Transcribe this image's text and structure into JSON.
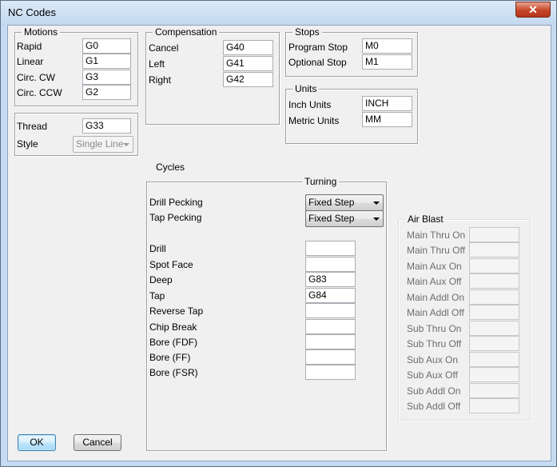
{
  "window": {
    "title": "NC Codes",
    "close_glyph": "✕"
  },
  "motions": {
    "legend": "Motions",
    "rows": [
      {
        "label": "Rapid",
        "value": "G0"
      },
      {
        "label": "Linear",
        "value": "G1"
      },
      {
        "label": "Circ. CW",
        "value": "G3"
      },
      {
        "label": "Circ. CCW",
        "value": "G2"
      }
    ]
  },
  "thread": {
    "label": "Thread",
    "value": "G33",
    "style_label": "Style",
    "style_value": "Single Line"
  },
  "compensation": {
    "legend": "Compensation",
    "rows": [
      {
        "label": "Cancel",
        "value": "G40"
      },
      {
        "label": "Left",
        "value": "G41"
      },
      {
        "label": "Right",
        "value": "G42"
      }
    ]
  },
  "stops": {
    "legend": "Stops",
    "rows": [
      {
        "label": "Program Stop",
        "value": "M0"
      },
      {
        "label": "Optional Stop",
        "value": "M1"
      }
    ]
  },
  "units": {
    "legend": "Units",
    "rows": [
      {
        "label": "Inch Units",
        "value": "INCH"
      },
      {
        "label": "Metric Units",
        "value": "MM"
      }
    ]
  },
  "cycles": {
    "label": "Cycles",
    "legend": "Turning",
    "drill_pecking": {
      "label": "Drill Pecking",
      "value": "Fixed Step"
    },
    "tap_pecking": {
      "label": "Tap Pecking",
      "value": "Fixed Step"
    },
    "rows": [
      {
        "label": "Drill",
        "value": ""
      },
      {
        "label": "Spot Face",
        "value": ""
      },
      {
        "label": "Deep",
        "value": "G83"
      },
      {
        "label": "Tap",
        "value": "G84"
      },
      {
        "label": "Reverse Tap",
        "value": ""
      },
      {
        "label": "Chip Break",
        "value": ""
      },
      {
        "label": "Bore (FDF)",
        "value": ""
      },
      {
        "label": "Bore (FF)",
        "value": ""
      },
      {
        "label": "Bore (FSR)",
        "value": ""
      }
    ]
  },
  "air_blast": {
    "legend": "Air Blast",
    "rows": [
      {
        "label": "Main Thru On",
        "value": ""
      },
      {
        "label": "Main Thru Off",
        "value": ""
      },
      {
        "label": "Main Aux On",
        "value": ""
      },
      {
        "label": "Main Aux Off",
        "value": ""
      },
      {
        "label": "Main Addl On",
        "value": ""
      },
      {
        "label": "Main Addl Off",
        "value": ""
      },
      {
        "label": "Sub Thru On",
        "value": ""
      },
      {
        "label": "Sub Thru Off",
        "value": ""
      },
      {
        "label": "Sub Aux On",
        "value": ""
      },
      {
        "label": "Sub Aux Off",
        "value": ""
      },
      {
        "label": "Sub Addl On",
        "value": ""
      },
      {
        "label": "Sub Addl Off",
        "value": ""
      }
    ]
  },
  "buttons": {
    "ok": "OK",
    "cancel": "Cancel"
  }
}
